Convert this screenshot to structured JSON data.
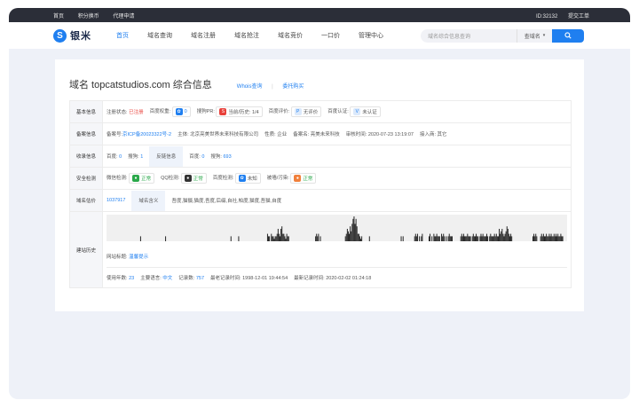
{
  "topbar": {
    "left": [
      "首页",
      "积分换币",
      "代理申请"
    ],
    "right": [
      "ID:32132",
      "提交工单"
    ]
  },
  "header": {
    "logo_text": "银米",
    "nav": [
      "首页",
      "域名查询",
      "域名注册",
      "域名抢注",
      "域名竞价",
      "一口价",
      "管理中心"
    ],
    "active_nav": "首页",
    "search_placeholder": "域名综合信息查询",
    "search_select": "查域名",
    "accent": "#1f7ff0"
  },
  "page": {
    "title": "域名 topcatstudios.com 综合信息",
    "links": [
      "Whois查询",
      "委托购买"
    ]
  },
  "basic": {
    "label": "基本信息",
    "reg_status_label": "注册状态:",
    "reg_status": "已注册",
    "baidu_weight_label": "百度权重:",
    "baidu_weight": "0",
    "sogou_pr_label": "搜狗PR:",
    "sogou_pr": "当前/历史: 1/4",
    "beian_score_label": "百度评价:",
    "beian_score": "无评价",
    "baidu_cert_label": "百度认证:",
    "baidu_cert": "未认证"
  },
  "icp": {
    "label": "备案信息",
    "icp_no_label": "备案号:",
    "icp_no": "京ICP备20023322号-2",
    "org_label": "主体:",
    "org": "北京亮美世界未来科技有限公司",
    "nature_label": "性质:",
    "nature": "企业",
    "site_label": "备案名:",
    "site": "亮美未来科技",
    "audit_label": "审核时间:",
    "audit": "2020-07-23 13:19:07",
    "access_label": "接入商:",
    "access": "其它"
  },
  "index": {
    "label": "收录信息",
    "baidu_label": "百度:",
    "baidu": "0",
    "sogou_label": "搜狗:",
    "sogou": "1",
    "backlink_tab": "反链信息",
    "bl_baidu_label": "百度:",
    "bl_baidu": "0",
    "bl_sogou_label": "搜狗:",
    "bl_sogou": "693"
  },
  "security": {
    "label": "安全检测",
    "wechat_label": "微信检测:",
    "wechat": "正常",
    "qq_label": "QQ检测:",
    "qq": "正常",
    "baidu_label": "百度检测:",
    "baidu": "未知",
    "tamper_label": "被墙/污染:",
    "tamper": "正常"
  },
  "value": {
    "label": "域名估价",
    "price": "1037917",
    "meaning_tab": "域名含义",
    "meaning": "吾度,猫摄,猫度,吾度,后缀,自社,帕度,猫度,吾猫,自度"
  },
  "history": {
    "label": "建站历史",
    "site_title_label": "网站标题:",
    "site_title": "温馨提示",
    "years_label": "使用年数:",
    "years": "23",
    "lang_label": "主要语言:",
    "lang": "中文",
    "records_label": "记录数:",
    "records": "757",
    "earliest_label": "最老记录时间:",
    "earliest": "1998-12-01 19:44:54",
    "latest_label": "最新记录时间:",
    "latest": "2020-02-02 01:24:18"
  },
  "chart_data": {
    "type": "bar",
    "values": [
      0,
      0,
      0,
      0,
      0,
      0,
      0,
      0,
      0,
      0,
      0,
      0,
      0,
      0,
      0,
      0,
      0,
      0,
      0,
      0,
      0,
      0,
      0,
      0,
      0,
      0,
      0,
      0,
      0,
      0,
      0,
      0,
      0,
      0,
      0,
      2,
      0,
      0,
      0,
      0,
      0,
      0,
      0,
      0,
      0,
      0,
      0,
      0,
      0,
      0,
      0,
      0,
      0,
      0,
      0,
      0,
      0,
      0,
      0,
      0,
      0,
      2,
      0,
      0,
      0,
      0,
      0,
      0,
      0,
      0,
      0,
      0,
      0,
      0,
      0,
      0,
      0,
      0,
      0,
      0,
      0,
      0,
      0,
      0,
      0,
      0,
      0,
      0,
      0,
      0,
      0,
      0,
      0,
      0,
      0,
      0,
      0,
      0,
      0,
      0,
      0,
      0,
      0,
      0,
      0,
      0,
      0,
      0,
      0,
      0,
      0,
      0,
      0,
      0,
      0,
      0,
      0,
      0,
      0,
      0,
      0,
      0,
      0,
      0,
      0,
      0,
      0,
      0,
      0,
      2,
      0,
      0,
      0,
      0,
      0,
      0,
      0,
      2,
      0,
      0,
      0,
      0,
      0,
      0,
      0,
      0,
      0,
      0,
      0,
      0,
      0,
      0,
      0,
      0,
      0,
      0,
      0,
      0,
      0,
      0,
      0,
      0,
      0,
      0,
      0,
      0,
      0,
      3,
      2,
      2,
      0,
      3,
      2,
      2,
      1,
      2,
      2,
      3,
      5,
      3,
      2,
      5,
      6,
      3,
      3,
      2,
      1,
      3,
      2,
      2,
      0,
      0,
      0,
      0,
      0,
      0,
      0,
      0,
      0,
      0,
      0,
      0,
      0,
      0,
      0,
      0,
      0,
      0,
      0,
      0,
      0,
      0,
      0,
      0,
      0,
      0,
      0,
      2,
      3,
      2,
      3,
      0,
      2,
      0,
      0,
      0,
      0,
      0,
      0,
      0,
      0,
      0,
      0,
      0,
      0,
      0,
      0,
      0,
      0,
      0,
      0,
      0,
      0,
      0,
      0,
      0,
      0,
      0,
      2,
      3,
      5,
      4,
      3,
      6,
      4,
      7,
      9,
      10,
      7,
      9,
      6,
      3,
      3,
      2,
      1,
      2,
      0,
      0,
      0,
      0,
      0,
      0,
      0,
      2,
      0,
      0,
      0,
      0,
      0,
      0,
      0,
      0,
      0,
      0,
      0,
      0,
      0,
      0,
      0,
      0,
      0,
      0,
      0,
      0,
      0,
      0,
      0,
      0,
      0,
      0,
      0,
      0,
      0,
      0,
      0,
      0,
      2,
      0,
      2,
      0,
      0,
      0,
      0,
      0,
      0,
      0,
      0,
      0,
      0,
      0,
      2,
      3,
      2,
      3,
      0,
      2,
      0,
      2,
      3,
      0,
      0,
      0,
      0,
      0,
      0,
      2,
      3,
      0,
      2,
      0,
      3,
      2,
      2,
      3,
      2,
      2,
      2,
      0,
      3,
      2,
      3,
      2,
      0,
      2,
      0,
      2,
      3,
      2,
      2,
      2,
      0,
      0,
      0,
      0,
      0,
      0,
      0,
      0,
      2,
      3,
      2,
      3,
      2,
      2,
      2,
      3,
      2,
      2,
      2,
      0,
      2,
      3,
      2,
      2,
      3,
      2,
      2,
      0,
      2,
      3,
      2,
      3,
      2,
      2,
      2,
      3,
      2,
      0,
      2,
      3,
      2,
      2,
      2,
      3,
      2,
      3,
      2,
      2,
      5,
      3,
      4,
      5,
      3,
      2,
      3,
      4,
      6,
      5,
      3,
      2,
      3,
      2,
      0,
      0,
      0,
      0,
      0,
      0,
      0,
      0,
      0,
      0,
      0,
      0,
      0,
      0,
      0,
      0,
      0,
      0,
      0,
      0,
      0,
      2,
      3,
      2,
      3,
      2,
      0,
      0,
      0,
      2,
      3,
      2,
      3,
      2,
      2,
      3,
      2,
      2,
      3,
      2,
      3,
      2,
      2,
      3,
      2,
      3,
      2,
      3,
      2,
      2,
      3,
      2,
      2,
      0,
      0,
      0,
      0
    ],
    "ylim": [
      0,
      10
    ]
  }
}
